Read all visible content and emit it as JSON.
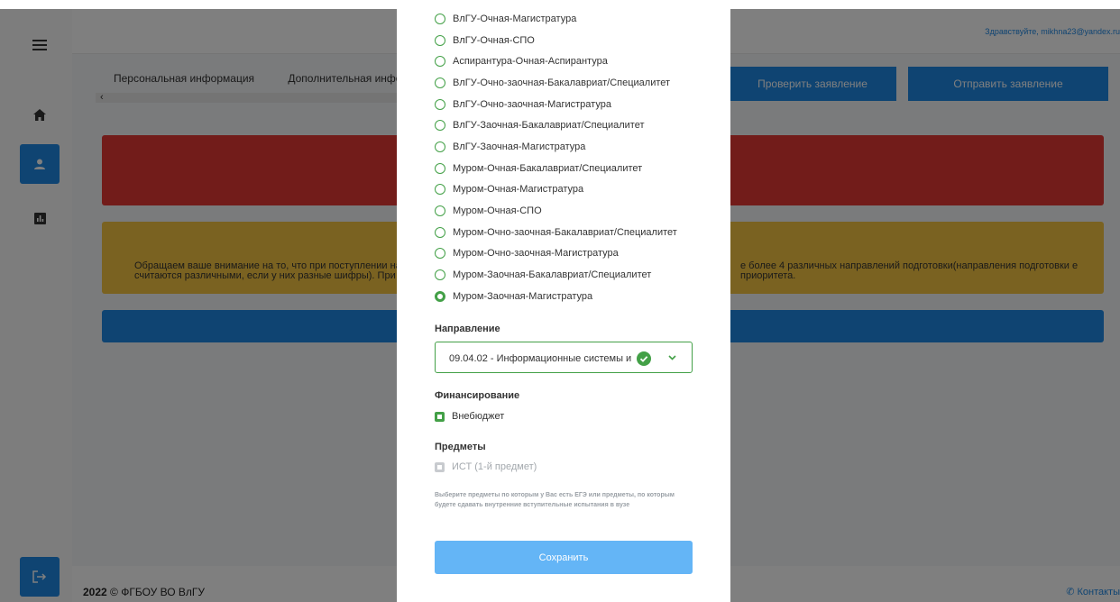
{
  "header": {
    "greeting": "Здравствуйте, mikhna23@yandex.ru",
    "tabs": [
      "Персональная информация",
      "Дополнительная информац"
    ],
    "tab_scroll_icon": "‹",
    "check_button": "Проверить заявление",
    "send_button": "Отправить заявление"
  },
  "sidebar": {
    "icons": [
      "menu-icon",
      "home-icon",
      "user-icon",
      "stats-icon",
      "logout-icon"
    ]
  },
  "alerts": {
    "notice_left": "Обращаем ваше внимание на то, что при поступлении на считаются различными, если у них разные шифры). При по",
    "notice_right": "е более 4 различных направлений подготовки(направления подготовки е приоритета."
  },
  "footer": {
    "year": "2022",
    "org": "© ФГБОУ ВО ВлГУ",
    "contacts": "Контакты"
  },
  "modal": {
    "options": [
      "ВлГУ-Очная-Магистратура",
      "ВлГУ-Очная-СПО",
      "Аспирантура-Очная-Аспирантура",
      "ВлГУ-Очно-заочная-Бакалавриат/Специалитет",
      "ВлГУ-Очно-заочная-Магистратура",
      "ВлГУ-Заочная-Бакалавриат/Специалитет",
      "ВлГУ-Заочная-Магистратура",
      "Муром-Очная-Бакалавриат/Специалитет",
      "Муром-Очная-Магистратура",
      "Муром-Очная-СПО",
      "Муром-Очно-заочная-Бакалавриат/Специалитет",
      "Муром-Очно-заочная-Магистратура",
      "Муром-Заочная-Бакалавриат/Специалитет",
      "Муром-Заочная-Магистратура"
    ],
    "selected_option": "Муром-Заочная-Магистратура",
    "direction_label": "Направление",
    "direction_value": "09.04.02 - Информационные системы и",
    "financing_label": "Финансирование",
    "financing_value": "Внебюджет",
    "subjects_label": "Предметы",
    "subject_value": "ИСТ (1-й предмет)",
    "hint": "Выберите предметы по которым у Вас есть ЕГЭ или предметы, по которым будете сдавать внутренние вступительные испытания в вузе",
    "save_button": "Сохранить"
  },
  "colors": {
    "accent": "#1e88e5",
    "success": "#43a047",
    "danger": "#e53935",
    "warning": "#f5c542"
  }
}
